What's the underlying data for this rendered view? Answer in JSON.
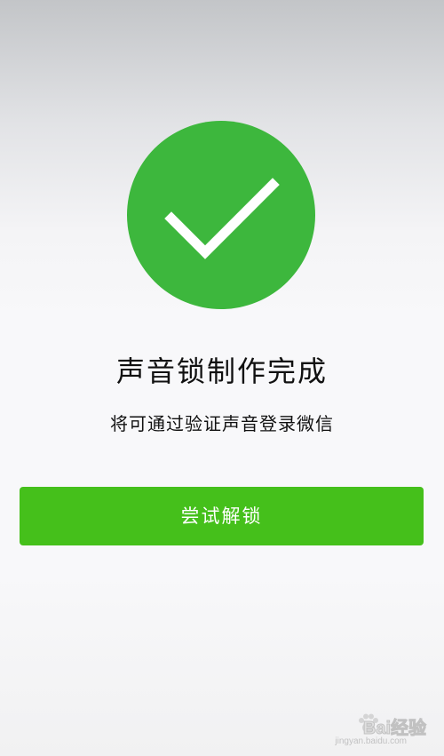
{
  "status": {
    "icon": "checkmark-icon",
    "color": "#3db73d"
  },
  "title": "声音锁制作完成",
  "subtitle": "将可通过验证声音登录微信",
  "primary_button": {
    "label": "尝试解锁",
    "color": "#45c01b"
  },
  "watermark": {
    "text": "Bai经验",
    "url": "jingyan.baidu.com"
  }
}
